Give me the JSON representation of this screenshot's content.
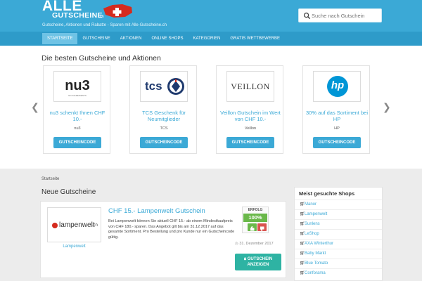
{
  "header": {
    "logo_top": "ALLE",
    "logo_bottom": "GUTSCHEINE",
    "logo_tld": ".ch",
    "tagline": "Gutscheine, Aktionen und Rabatte - Sparen mit Alle-Gutscheine.ch",
    "search_placeholder": "Suche nach Gutschein",
    "colors": {
      "header": "#3ba9d6",
      "nav": "#2e9bc9",
      "nav_active": "#6fc3e5",
      "accent": "#3ba9d6",
      "success": "#6ab84a",
      "cta": "#2eb3a3"
    }
  },
  "nav": [
    {
      "label": "STARTSEITE",
      "active": true
    },
    {
      "label": "GUTSCHEINE"
    },
    {
      "label": "AKTIONEN"
    },
    {
      "label": "ONLINE SHOPS"
    },
    {
      "label": "KATEGORIEN"
    },
    {
      "label": "GRATIS WETTBEWERBE"
    }
  ],
  "top": {
    "title": "Die besten Gutscheine und Aktionen",
    "prev_icon": "chevron-left-icon",
    "next_icon": "chevron-right-icon",
    "cards": [
      {
        "logo_text": "nu3",
        "logo_sub": "NO INGREDIENTS",
        "title": "nu3 schenkt Ihnen CHF 10.-",
        "store": "nu3",
        "button": "GUTSCHEINCODE"
      },
      {
        "logo_text": "tcs",
        "title": "TCS Geschenk für Neumitglieder",
        "store": "TCS",
        "button": "GUTSCHEINCODE"
      },
      {
        "logo_text": "VEILLON",
        "title": "Veillon Gutschein im Wert von CHF 10.-",
        "store": "Veillon",
        "button": "GUTSCHEINCODE"
      },
      {
        "logo_text": "hp",
        "title": "30% auf das Sortiment bei HP",
        "store": "HP",
        "button": "GUTSCHEINCODE"
      }
    ]
  },
  "breadcrumb": "Startseite",
  "new_section": {
    "title": "Neue Gutscheine",
    "coupon": {
      "logo_text": "lampenwelt",
      "logo_tld": ".ch",
      "store": "Lampenwelt",
      "title": "CHF 15.- Lampenwelt Gutschein",
      "description": "Bei Lampenwelt können Sie aktuell CHF 15.- ab einem Mindestkaufpreis von CHF 180.- sparen. Das Angebot gilt bis am 31.12.2017 auf das gesamte Sortiment. Pro Bestellung und pro Kunde nur ein Gutscheincode gültig.",
      "date": "31. Dezember 2017",
      "success_label": "ERFOLG",
      "success_rate": "100%",
      "button_line1": "GUTSCHEIN",
      "button_line2": "ANZEIGEN"
    }
  },
  "sidebar": {
    "title": "Meist gesuchte Shops",
    "items": [
      "Manor",
      "Lampenwelt",
      "Sunlens",
      "LeShop",
      "AXA Winterthur",
      "Baby Markt",
      "Blue Tomato",
      "Conforama"
    ]
  }
}
